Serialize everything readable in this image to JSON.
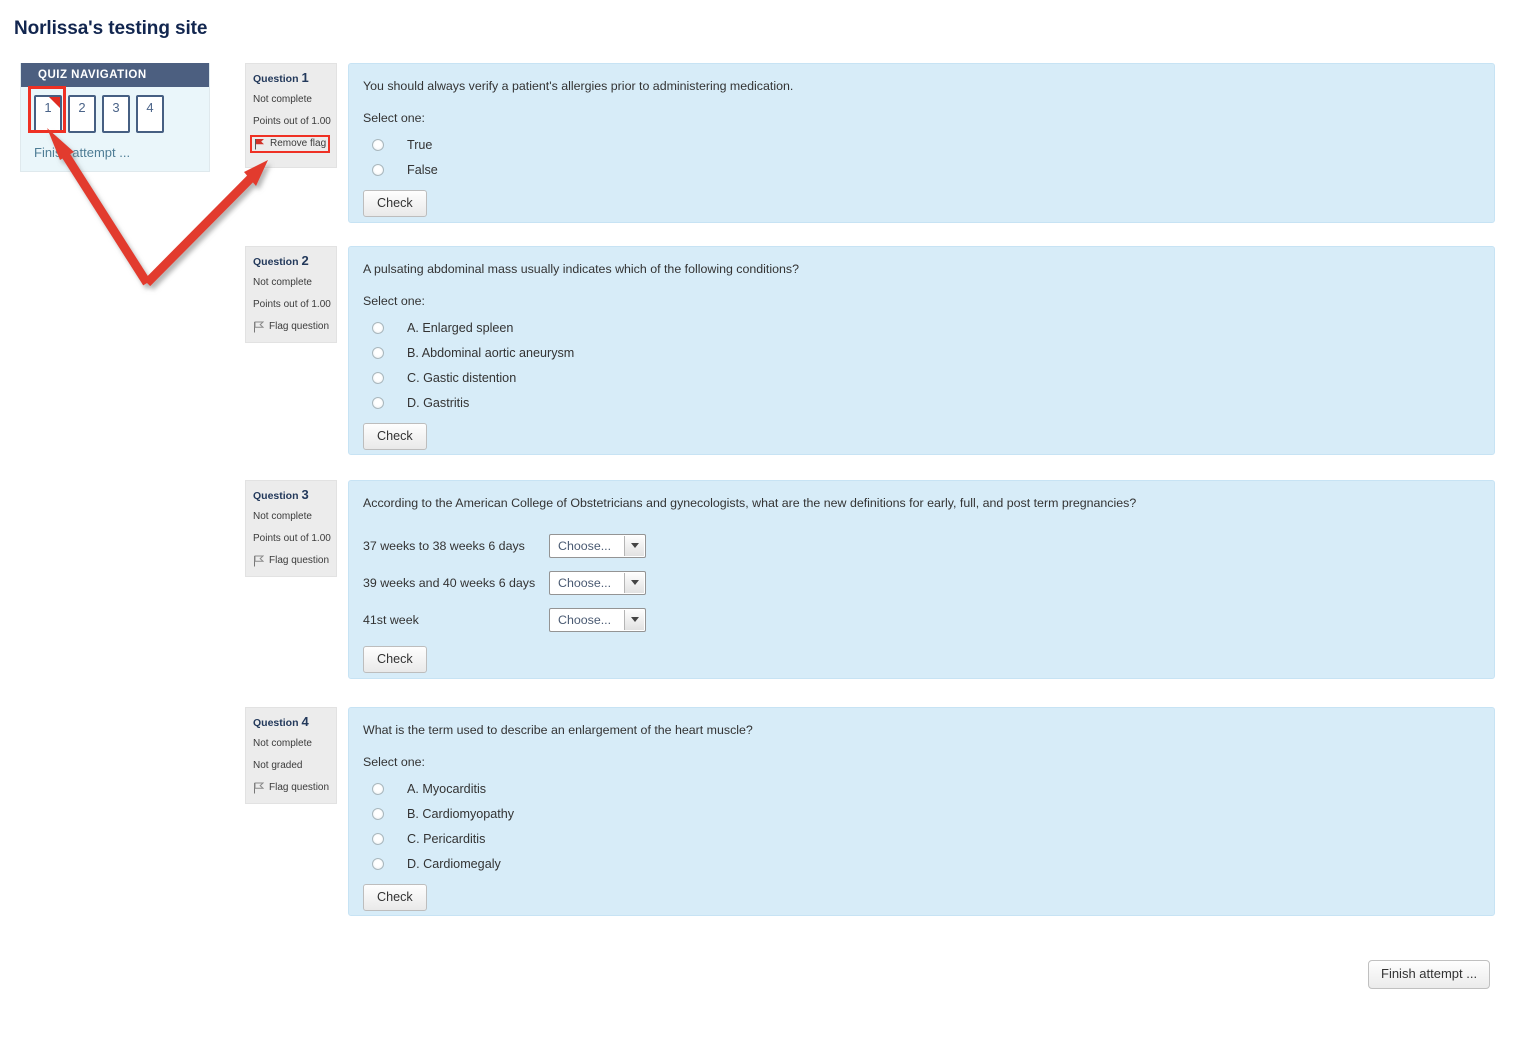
{
  "page": {
    "title": "Norlissa's testing site"
  },
  "quiz_navigation": {
    "header": "QUIZ NAVIGATION",
    "buttons": [
      {
        "label": "1",
        "flagged": true
      },
      {
        "label": "2",
        "flagged": false
      },
      {
        "label": "3",
        "flagged": false
      },
      {
        "label": "4",
        "flagged": false
      }
    ],
    "finish_link": "Finish attempt ..."
  },
  "questions": [
    {
      "number_label": "Question",
      "number": "1",
      "status": "Not complete",
      "points": "Points out of 1.00",
      "flag_label": "Remove flag",
      "flag_icon": "flag-filled-icon",
      "flag_highlighted": true,
      "text": "You should always verify a patient's allergies prior to administering medication.",
      "select_one": "Select one:",
      "type": "radio",
      "options": [
        "True",
        "False"
      ],
      "check_label": "Check"
    },
    {
      "number_label": "Question",
      "number": "2",
      "status": "Not complete",
      "points": "Points out of 1.00",
      "flag_label": "Flag question",
      "flag_icon": "flag-outline-icon",
      "flag_highlighted": false,
      "text": "A pulsating abdominal mass usually indicates which of the following conditions?",
      "select_one": "Select one:",
      "type": "radio",
      "options": [
        "A. Enlarged spleen",
        "B. Abdominal aortic aneurysm",
        "C. Gastic distention",
        "D. Gastritis"
      ],
      "check_label": "Check"
    },
    {
      "number_label": "Question",
      "number": "3",
      "status": "Not complete",
      "points": "Points out of 1.00",
      "flag_label": "Flag question",
      "flag_icon": "flag-outline-icon",
      "flag_highlighted": false,
      "text": "According to the American College of Obstetricians and gynecologists, what are the new definitions for early, full, and post term pregnancies?",
      "type": "match",
      "match_rows": [
        {
          "label": "37 weeks to 38 weeks 6 days",
          "selected": "Choose..."
        },
        {
          "label": "39 weeks and 40 weeks 6 days",
          "selected": "Choose..."
        },
        {
          "label": "41st week",
          "selected": "Choose..."
        }
      ],
      "check_label": "Check"
    },
    {
      "number_label": "Question",
      "number": "4",
      "status": "Not complete",
      "points": "Not graded",
      "flag_label": "Flag question",
      "flag_icon": "flag-outline-icon",
      "flag_highlighted": false,
      "text": "What is the term used to describe an enlargement of the heart muscle?",
      "select_one": "Select one:",
      "type": "radio",
      "options": [
        "A. Myocarditis",
        "B. Cardiomyopathy",
        "C. Pericarditis",
        "D. Cardiomegaly"
      ],
      "check_label": "Check"
    }
  ],
  "footer": {
    "finish_attempt_label": "Finish attempt ..."
  },
  "colors": {
    "nav_header_bg": "#4c5f80",
    "nav_body_bg": "#eaf6fa",
    "question_bg": "#d7ecf8",
    "info_bg": "#ececec",
    "annotation_red": "#ef3124",
    "title_color": "#12264f"
  }
}
